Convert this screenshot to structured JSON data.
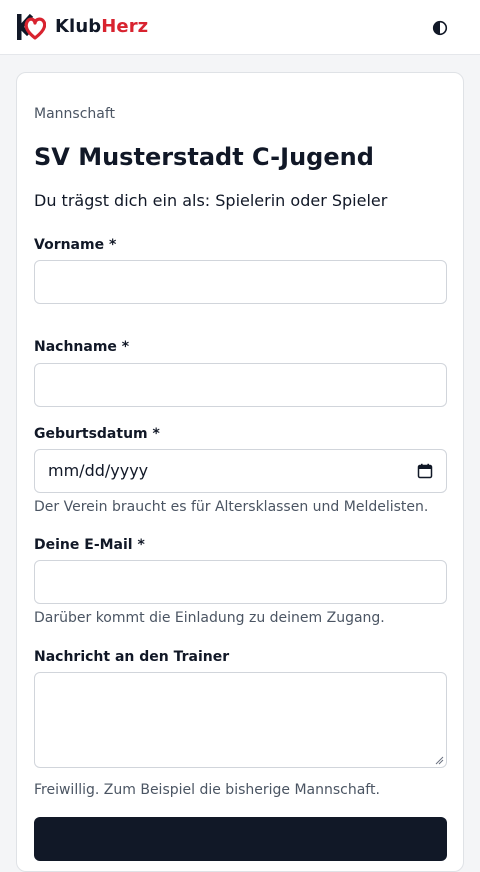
{
  "header": {
    "brand_part1": "Klub",
    "brand_part2": "Herz",
    "brand_accent_color": "#d8232f",
    "theme_toggle_icon": "half-circle-contrast-icon"
  },
  "form": {
    "kicker": "Mannschaft",
    "team_name": "SV Musterstadt C-Jugend",
    "intro": "Du trägst dich ein als: Spielerin oder Spieler",
    "first_name": {
      "label": "Vorname *",
      "value": ""
    },
    "last_name": {
      "label": "Nachname *",
      "value": ""
    },
    "birthdate": {
      "label": "Geburtsdatum *",
      "placeholder": "mm/dd/yyyy",
      "icon": "calendar-icon",
      "help": "Der Verein braucht es für Altersklassen und Meldelisten."
    },
    "email": {
      "label": "Deine E-Mail *",
      "value": "",
      "help": "Darüber kommt die Einladung zu deinem Zugang."
    },
    "message": {
      "label": "Nachricht an den Trainer",
      "value": "",
      "help": "Freiwillig. Zum Beispiel die bisherige Mannschaft."
    }
  }
}
